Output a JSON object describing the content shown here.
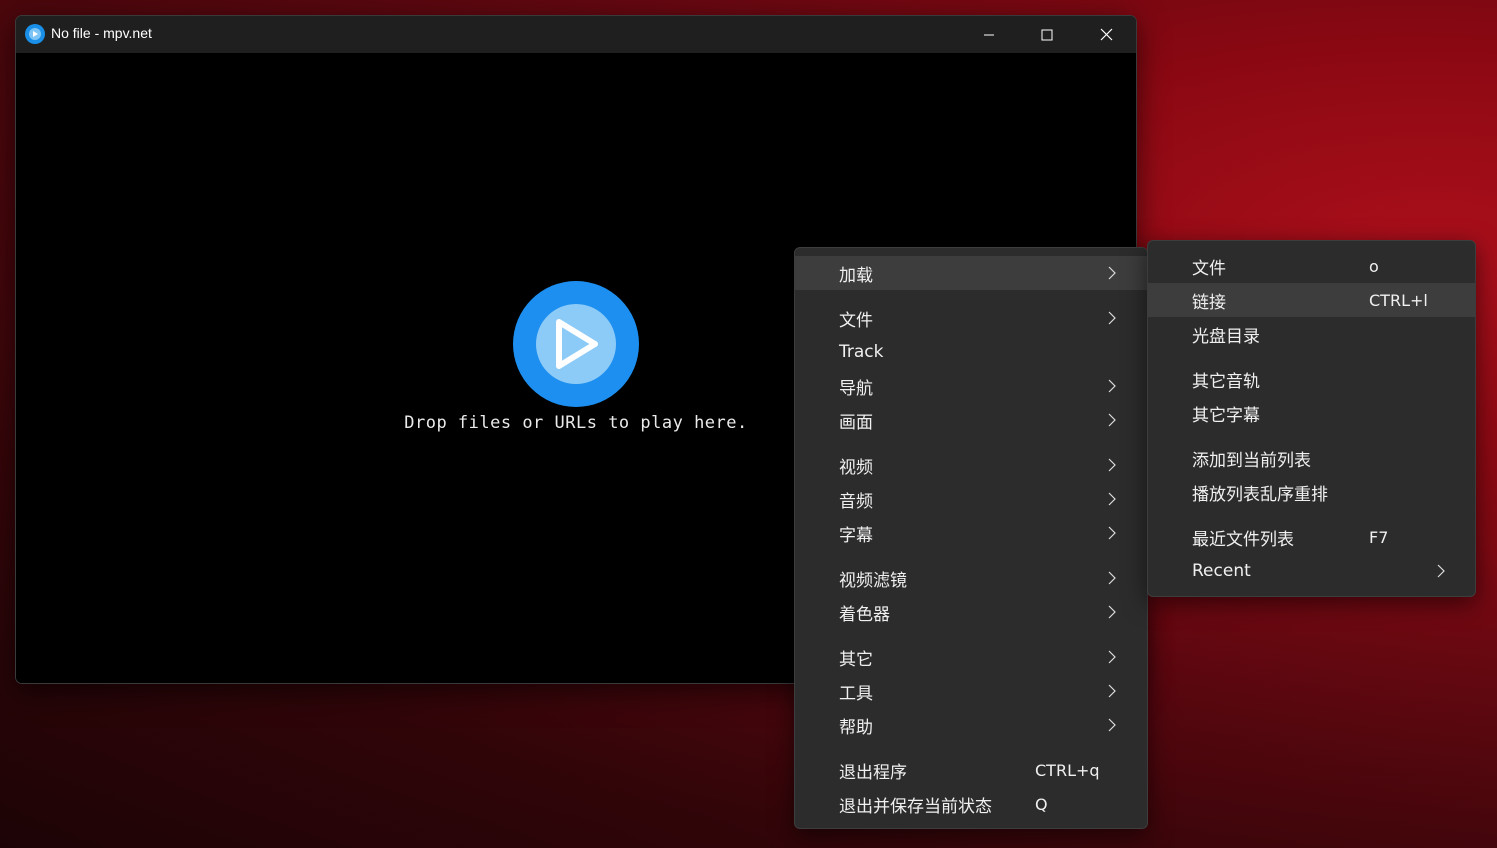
{
  "window": {
    "title": "No file - mpv.net",
    "drop_hint": "Drop files or URLs to play here."
  },
  "main_menu": {
    "items": [
      {
        "label": "加载",
        "shortcut": "",
        "submenu": true,
        "highlighted": true
      },
      {
        "label": "文件",
        "shortcut": "",
        "submenu": true
      },
      {
        "label": "Track",
        "shortcut": "",
        "submenu": false
      },
      {
        "label": "导航",
        "shortcut": "",
        "submenu": true
      },
      {
        "label": "画面",
        "shortcut": "",
        "submenu": true
      },
      {
        "label": "视频",
        "shortcut": "",
        "submenu": true
      },
      {
        "label": "音频",
        "shortcut": "",
        "submenu": true
      },
      {
        "label": "字幕",
        "shortcut": "",
        "submenu": true
      },
      {
        "label": "视频滤镜",
        "shortcut": "",
        "submenu": true
      },
      {
        "label": "着色器",
        "shortcut": "",
        "submenu": true
      },
      {
        "label": "其它",
        "shortcut": "",
        "submenu": true
      },
      {
        "label": "工具",
        "shortcut": "",
        "submenu": true
      },
      {
        "label": "帮助",
        "shortcut": "",
        "submenu": true
      },
      {
        "label": "退出程序",
        "shortcut": "CTRL+q",
        "submenu": false
      },
      {
        "label": "退出并保存当前状态",
        "shortcut": "Q",
        "submenu": false
      }
    ]
  },
  "sub_menu": {
    "items": [
      {
        "label": "文件",
        "shortcut": "o",
        "submenu": false
      },
      {
        "label": "链接",
        "shortcut": "CTRL+l",
        "submenu": false,
        "highlighted": true
      },
      {
        "label": "光盘目录",
        "shortcut": "",
        "submenu": false
      },
      {
        "label": "其它音轨",
        "shortcut": "",
        "submenu": false
      },
      {
        "label": "其它字幕",
        "shortcut": "",
        "submenu": false
      },
      {
        "label": "添加到当前列表",
        "shortcut": "",
        "submenu": false
      },
      {
        "label": "播放列表乱序重排",
        "shortcut": "",
        "submenu": false
      },
      {
        "label": "最近文件列表",
        "shortcut": "F7",
        "submenu": false
      },
      {
        "label": "Recent",
        "shortcut": "",
        "submenu": true
      }
    ]
  },
  "colors": {
    "accent": "#1c8ff0",
    "menu_bg": "#2c2c2c",
    "menu_highlight": "#3d3d3d"
  }
}
